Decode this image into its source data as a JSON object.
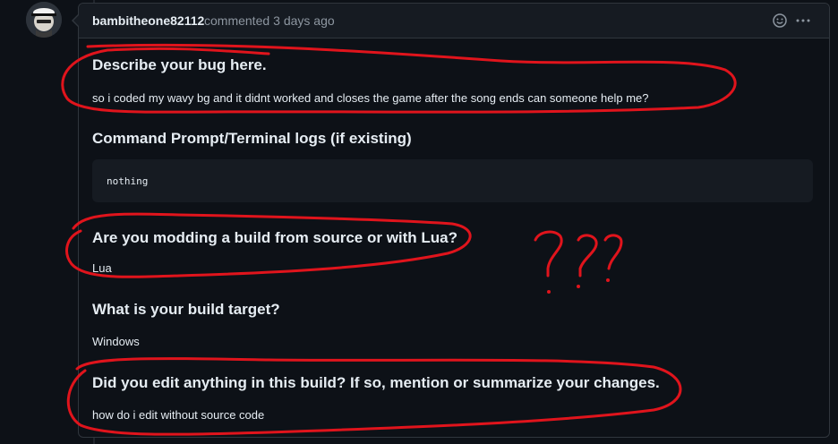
{
  "comment": {
    "author": "bambitheone82112",
    "action": "commented",
    "time": "3 days ago"
  },
  "sections": [
    {
      "heading": "Describe your bug here.",
      "text": "so i coded my wavy bg and it didnt worked and closes the game after the song ends can someone help me?"
    },
    {
      "heading": "Command Prompt/Terminal logs (if existing)",
      "code": "nothing"
    },
    {
      "heading": "Are you modding a build from source or with Lua?",
      "text": "Lua"
    },
    {
      "heading": "What is your build target?",
      "text": "Windows"
    },
    {
      "heading": "Did you edit anything in this build? If so, mention or summarize your changes.",
      "text": "how do i edit without source code"
    }
  ],
  "annotation_color": "#e0141c",
  "icons": {
    "reaction": "smiley-icon",
    "menu": "kebab-horizontal-icon"
  }
}
